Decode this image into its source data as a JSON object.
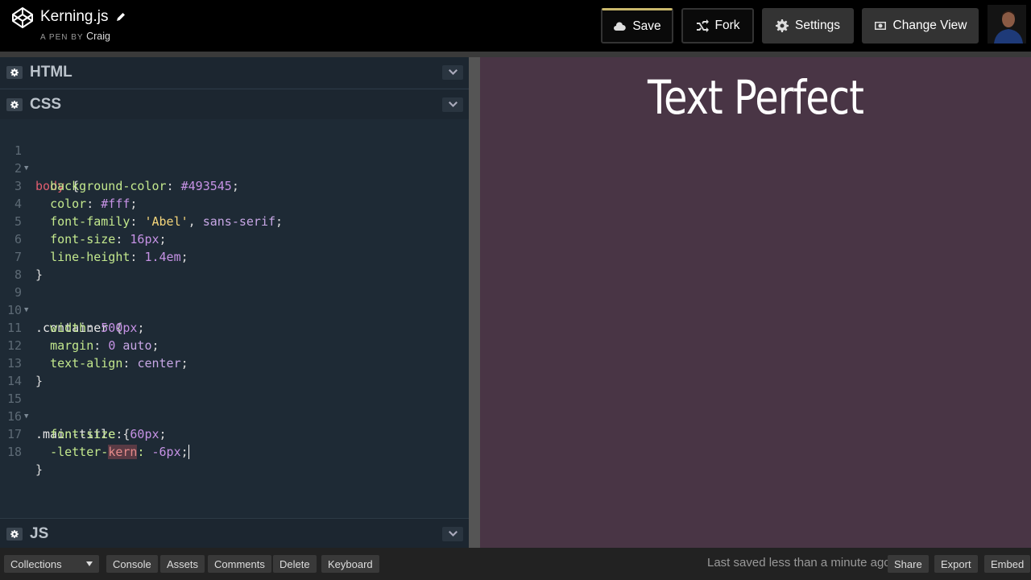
{
  "header": {
    "title": "Kerning.js",
    "by_label": "A PEN BY",
    "author": "Craig",
    "buttons": {
      "save": "Save",
      "fork": "Fork",
      "settings": "Settings",
      "change_view": "Change View"
    }
  },
  "editors": {
    "html_label": "HTML",
    "css_label": "CSS",
    "js_label": "JS",
    "css_lines": [
      {
        "n": "1",
        "fold": true
      },
      {
        "n": "2"
      },
      {
        "n": "3"
      },
      {
        "n": "4"
      },
      {
        "n": "5"
      },
      {
        "n": "6"
      },
      {
        "n": "7"
      },
      {
        "n": "8"
      },
      {
        "n": "9",
        "fold": true
      },
      {
        "n": "10"
      },
      {
        "n": "11"
      },
      {
        "n": "12"
      },
      {
        "n": "13"
      },
      {
        "n": "14"
      },
      {
        "n": "15",
        "fold": true
      },
      {
        "n": "16"
      },
      {
        "n": "17"
      },
      {
        "n": "18"
      }
    ],
    "code": {
      "l1_sel": "body",
      "l1_brace": " {",
      "l2_prop": "background-color",
      "l2_val": "#493545",
      "l3_prop": "color",
      "l3_val": "#fff",
      "l4_prop": "font-family",
      "l4_str": "'Abel'",
      "l4_rest": "sans-serif",
      "l5_prop": "font-size",
      "l5_val": "16px",
      "l6_prop": "line-height",
      "l6_val": "1.4em",
      "close": "}",
      "l9_sel": ".container",
      "l10_prop": "width",
      "l10_val": "500px",
      "l11_prop": "margin",
      "l11_val0": "0",
      "l11_val": "auto",
      "l12_prop": "text-align",
      "l12_val": "center",
      "l15_sel": ".main-title",
      "l16_prop": "font-size",
      "l16_val": "60px",
      "l17_pre": "-letter-",
      "l17_warn": "kern",
      "l17_val": "-6px"
    }
  },
  "preview": {
    "title": "Text Perfect"
  },
  "footer": {
    "collections": "Collections",
    "console": "Console",
    "assets": "Assets",
    "comments": "Comments",
    "delete": "Delete",
    "keyboard": "Keyboard",
    "saved_status": "Last saved less than a minute ago",
    "share": "Share",
    "export": "Export",
    "embed": "Embed"
  },
  "colors": {
    "preview_bg": "#493545",
    "editor_bg": "#1e2a35",
    "save_accent": "#c9b76b"
  },
  "icons": [
    "codepen-logo-icon",
    "pencil-icon",
    "cloud-icon",
    "fork-icon",
    "gear-icon",
    "eye-icon",
    "chevron-down-icon"
  ]
}
